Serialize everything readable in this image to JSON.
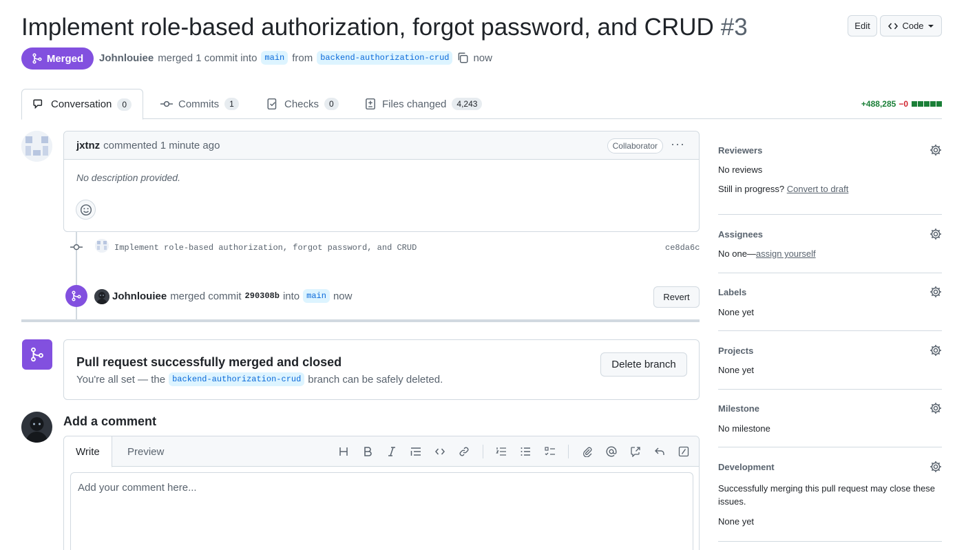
{
  "pr": {
    "title": "Implement role-based authorization, forgot password, and CRUD",
    "number": "#3",
    "status": "Merged",
    "author": "Johnlouiee",
    "merged_text": "merged 1 commit into",
    "base_branch": "main",
    "from_text": "from",
    "head_branch": "backend-authorization-crud",
    "time": "now"
  },
  "header": {
    "edit_label": "Edit",
    "code_label": "Code"
  },
  "tabs": [
    {
      "label": "Conversation",
      "count": "0"
    },
    {
      "label": "Commits",
      "count": "1"
    },
    {
      "label": "Checks",
      "count": "0"
    },
    {
      "label": "Files changed",
      "count": "4,243"
    }
  ],
  "diffstat": {
    "additions": "+488,285",
    "deletions": "−0",
    "colors": {
      "add": "#1a7f37",
      "del": "#d1242f"
    }
  },
  "comment": {
    "author": "jxtnz",
    "meta": "commented 1 minute ago",
    "role": "Collaborator",
    "menu": "···",
    "body": "No description provided."
  },
  "commit": {
    "message": "Implement role-based authorization, forgot password, and CRUD",
    "sha": "ce8da6c"
  },
  "merge_event": {
    "user": "Johnlouiee",
    "text": "merged commit",
    "sha": "290308b",
    "into": "into",
    "branch": "main",
    "time": "now",
    "revert_label": "Revert"
  },
  "merged_box": {
    "title": "Pull request successfully merged and closed",
    "sub_before": "You're all set — the",
    "branch": "backend-authorization-crud",
    "sub_after": "branch can be safely deleted.",
    "delete_label": "Delete branch"
  },
  "add_comment": {
    "title": "Add a comment",
    "tab_write": "Write",
    "tab_preview": "Preview",
    "placeholder": "Add your comment here...",
    "toolbar": [
      "heading-icon",
      "bold-icon",
      "italic-icon",
      "quote-icon",
      "code-icon",
      "link-icon",
      "numbered-list-icon",
      "bullet-list-icon",
      "task-list-icon",
      "attach-icon",
      "mention-icon",
      "cross-reference-icon",
      "reply-icon",
      "slash-command-icon"
    ]
  },
  "sidebar": {
    "reviewers": {
      "title": "Reviewers",
      "value": "No reviews",
      "progress_text": "Still in progress?",
      "draft_link": "Convert to draft"
    },
    "assignees": {
      "title": "Assignees",
      "value": "No one—",
      "link": "assign yourself"
    },
    "labels": {
      "title": "Labels",
      "value": "None yet"
    },
    "projects": {
      "title": "Projects",
      "value": "None yet"
    },
    "milestone": {
      "title": "Milestone",
      "value": "No milestone"
    },
    "development": {
      "title": "Development",
      "text": "Successfully merging this pull request may close these issues.",
      "value": "None yet"
    }
  },
  "colors": {
    "merged": "#8250df",
    "accent": "#0969da"
  }
}
